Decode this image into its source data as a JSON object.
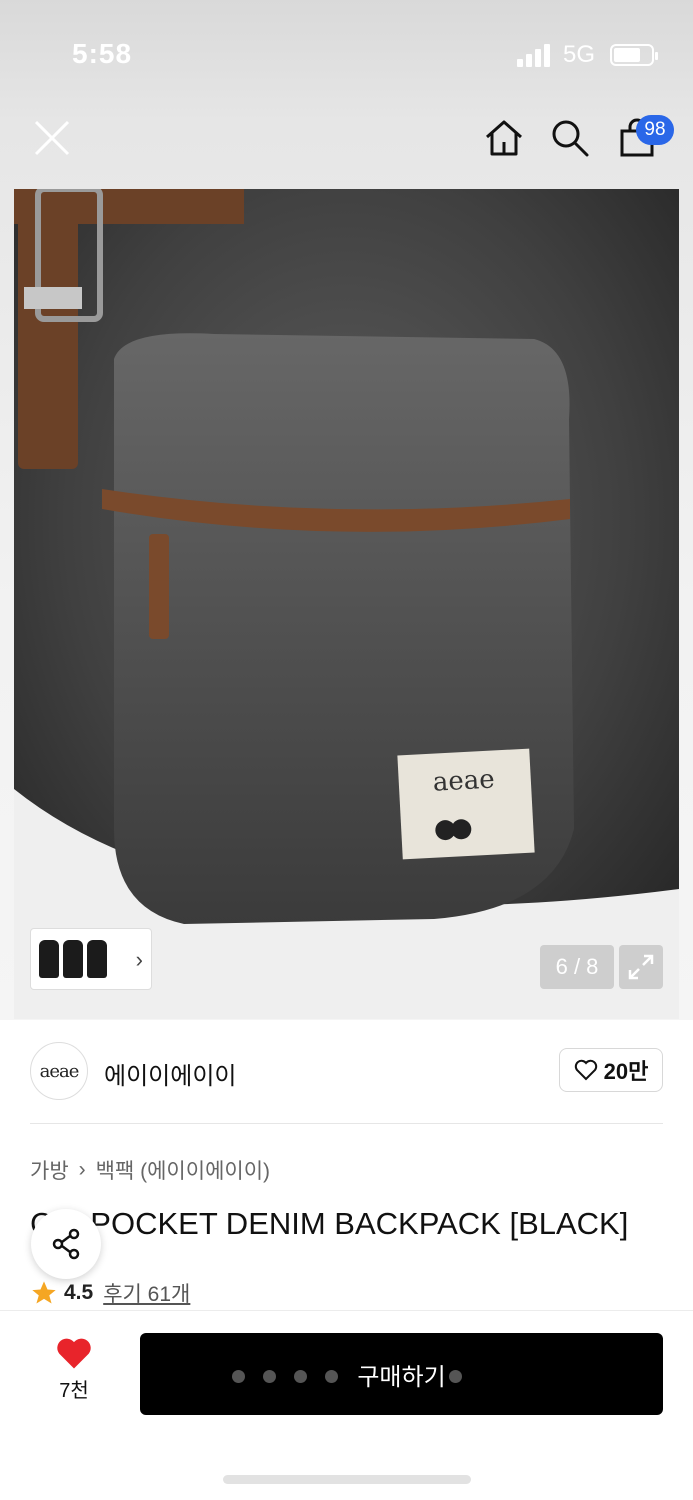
{
  "status_bar": {
    "time": "5:58",
    "network": "5G"
  },
  "navbar": {
    "close_icon": "close-icon",
    "home_icon": "home-icon",
    "search_icon": "search-icon",
    "cart_icon": "shopping-bag-icon",
    "cart_badge": "98"
  },
  "gallery": {
    "counter": "6 / 8"
  },
  "brand": {
    "logo_text": "aeae",
    "name": "에이이에이이",
    "likes": "20만"
  },
  "breadcrumb": {
    "level1": "가방",
    "separator": "›",
    "level2": "백팩 (에이이에이이)"
  },
  "product": {
    "title": "C   E POCKET DENIM BACKPACK [BLACK]",
    "rating": "4.5",
    "reviews": "후기 61개"
  },
  "bottom_bar": {
    "wish_count": "7천",
    "buy_label": "구매하기"
  },
  "colors": {
    "accent": "#2a67e8",
    "heart": "#e8242b",
    "star": "#f5a623",
    "buy_bg": "#000000"
  }
}
